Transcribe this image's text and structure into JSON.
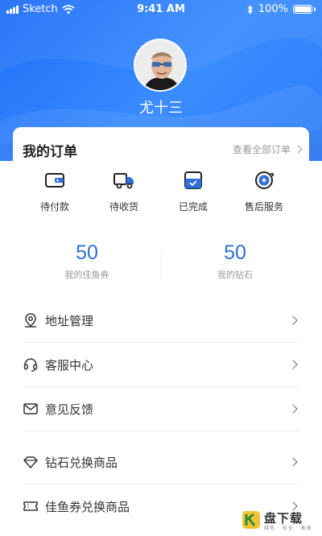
{
  "status_bar": {
    "carrier": "Sketch",
    "time": "9:41 AM",
    "battery": "100%"
  },
  "profile": {
    "name": "尤十三"
  },
  "orders": {
    "title": "我的订单",
    "view_all": "查看全部订单",
    "items": [
      {
        "label": "待付款",
        "icon": "wallet-icon"
      },
      {
        "label": "待收货",
        "icon": "truck-icon"
      },
      {
        "label": "已完成",
        "icon": "completed-box-icon"
      },
      {
        "label": "售后服务",
        "icon": "after-sales-icon"
      }
    ]
  },
  "stats": [
    {
      "value": "50",
      "label": "我的佳鱼券"
    },
    {
      "value": "50",
      "label": "我的钻石"
    }
  ],
  "menu": [
    {
      "label": "地址管理",
      "icon": "location-pin-icon"
    },
    {
      "label": "客服中心",
      "icon": "headset-icon"
    },
    {
      "label": "意见反馈",
      "icon": "envelope-icon"
    },
    {
      "label": "钻石兑换商品",
      "icon": "diamond-icon"
    },
    {
      "label": "佳鱼券兑换商品",
      "icon": "ticket-icon"
    }
  ],
  "watermark": {
    "title": "盘下载",
    "subtitle": "绿色 · 安全 · 高速"
  },
  "colors": {
    "header_blue": "#2f7df9",
    "accent_blue": "#2f6fd6"
  }
}
